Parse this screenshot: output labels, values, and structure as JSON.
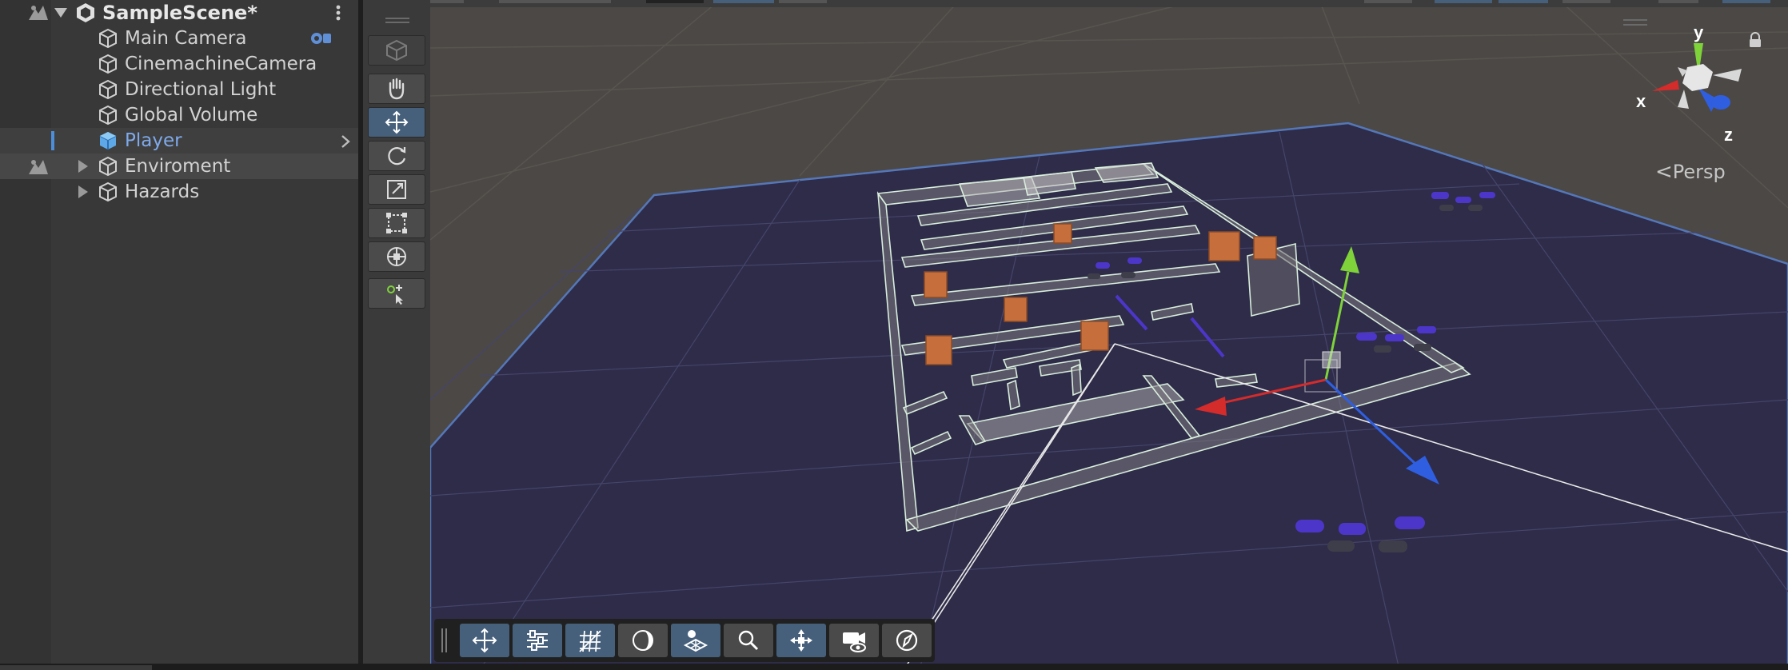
{
  "hierarchy": {
    "scene_name": "SampleScene*",
    "items": [
      {
        "label": "Main Camera",
        "icon": "gameobject-cube-icon"
      },
      {
        "label": "CinemachineCamera",
        "icon": "gameobject-cube-icon"
      },
      {
        "label": "Directional Light",
        "icon": "gameobject-cube-icon"
      },
      {
        "label": "Global Volume",
        "icon": "gameobject-cube-icon"
      },
      {
        "label": "Player",
        "icon": "prefab-cube-icon"
      },
      {
        "label": "Enviroment",
        "icon": "gameobject-cube-icon"
      },
      {
        "label": "Hazards",
        "icon": "gameobject-cube-icon"
      }
    ]
  },
  "scene_view": {
    "projection_label": "Persp",
    "gizmo_axes": {
      "x": "x",
      "y": "y",
      "z": "z"
    }
  },
  "tools": [
    "view-cube",
    "hand-tool",
    "move-tool",
    "rotate-tool",
    "scale-tool",
    "rect-tool",
    "transform-tool",
    "custom-tool"
  ],
  "overlay_toolbar": [
    "move-icon",
    "settings-sliders-icon",
    "grid-icon",
    "shading-icon",
    "layers-icon",
    "search-icon",
    "gizmo-icon",
    "camera-visibility-icon",
    "compass-icon"
  ],
  "colors": {
    "selection_blue": "#4c8ed9",
    "player_text": "#7fa9ea",
    "active_tool": "#46607c",
    "ground_plane": "#2e2c49",
    "axis_x": "#d42b2b",
    "axis_y": "#7fd23a",
    "axis_z": "#2f5fe0"
  }
}
